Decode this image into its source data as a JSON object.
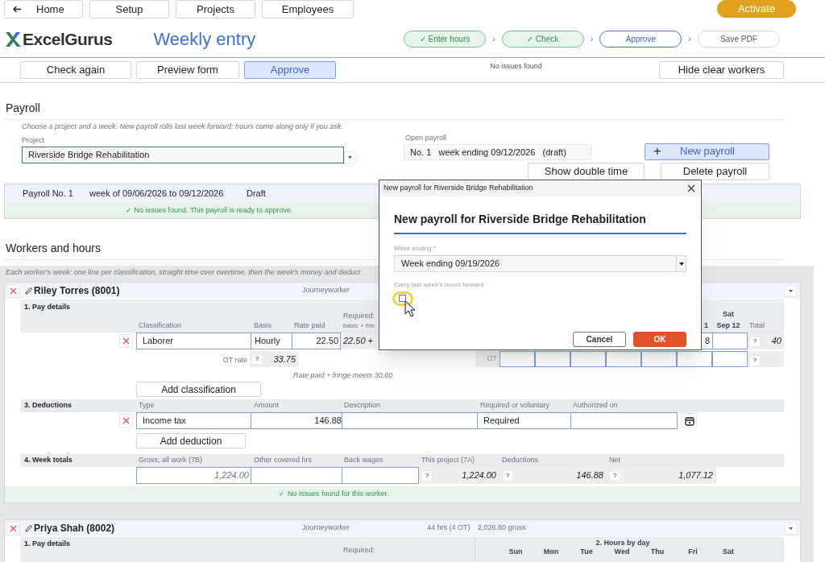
{
  "nav": {
    "back": "Home",
    "items": [
      "Setup",
      "Projects",
      "Employees"
    ],
    "activate": "Activate"
  },
  "header": {
    "logo": "ExcelGurus",
    "title": "Weekly entry",
    "steps": [
      {
        "label": "✓ Enter hours",
        "kind": "done"
      },
      {
        "separator": "›",
        "label": "✓ Check",
        "kind": "done"
      },
      {
        "separator": "›",
        "label": "Approve",
        "kind": "current"
      },
      {
        "separator": "›",
        "label": "Save PDF",
        "kind": "pending"
      }
    ]
  },
  "toolbar": {
    "buttons": [
      {
        "label": "Check again",
        "kind": "default"
      },
      {
        "label": "Preview form",
        "kind": "default"
      },
      {
        "label": "Approve",
        "kind": "primary"
      }
    ],
    "status": "No issues found",
    "right_button": "Hide clear workers"
  },
  "payroll": {
    "heading": "Payroll",
    "hint": "Choose a project and a week. New payroll rolls last week forward; hours come along only if you ask.",
    "project_label": "Project",
    "project": "Riverside Bridge Rehabilitation",
    "open_label": "Open payroll",
    "open_value": "No. 1   week ending 09/12/2026   (draft)",
    "new_button": {
      "icon": "+",
      "label": "New payroll"
    },
    "buttons": [
      "Show double time",
      "Delete payroll"
    ]
  },
  "summary": {
    "number": "Payroll No. 1",
    "week": "week of 09/06/2026 to 09/12/2026",
    "state": "Draft",
    "message": "✓ No issues found. This payroll is ready to approve."
  },
  "workers_section": {
    "heading": "Workers and hours",
    "hint": "Each worker's week: one line per classification, straight time over overtime, then the week's money and deduct"
  },
  "worker_1": {
    "name": "Riley Torres (8001)",
    "type": "Journeyworker",
    "pay": {
      "title": "1. Pay details",
      "columns": [
        "Classification",
        "Basis",
        "Rate paid"
      ],
      "required_label": [
        "Required:",
        "basic + frin"
      ],
      "row": {
        "classification": "Laborer",
        "basis": "Hourly",
        "rate_paid": "22.50",
        "required": "22.50 +"
      },
      "ot_label": "OT rate",
      "ot_help": "?",
      "ot_rate": "33.75",
      "note": "Rate paid + fringe meets 30.60"
    },
    "hours": {
      "fri_header": "1",
      "sat_header": [
        "Sat",
        "Sep 12"
      ],
      "total_label": "Total",
      "fri": "8",
      "st_help": "?",
      "st_total": "40",
      "ot_label": "OT",
      "ot_help": "?"
    },
    "add_classification": "Add classification",
    "deductions": {
      "title": "3. Deductions",
      "columns": [
        "Type",
        "Amount",
        "Description",
        "Required or voluntary",
        "Authorized on"
      ],
      "row": {
        "type": "Income tax",
        "amount": "146.88",
        "required": "Required"
      }
    },
    "add_deduction": "Add deduction",
    "totals": {
      "title": "4. Week totals",
      "columns": [
        "Gross, all work (7B)",
        "Other covered hrs",
        "Back wages",
        "This project (7A)",
        "Deductions",
        "Net"
      ],
      "gross": "1,224.00",
      "cells": [
        {
          "help": "?",
          "value": "1,224.00"
        },
        {
          "help": "?",
          "value": "146.88"
        },
        {
          "help": "?",
          "value": "1,077.12"
        }
      ]
    },
    "message": "✓ No issues found for this worker."
  },
  "worker_2": {
    "name": "Priya Shah (8002)",
    "type": "Journeyworker",
    "hours": "44 hrs (4 OT)",
    "gross": "2,026.80 gross",
    "pay_title": "1. Pay details",
    "required_label": "Required:",
    "hours_title": "2. Hours by day",
    "days": [
      "Sun",
      "Mon",
      "Tue",
      "Wed",
      "Thu",
      "Fri",
      "Sat"
    ]
  },
  "dialog": {
    "title": "New payroll for Riverside Bridge Rehabilitation",
    "heading": "New payroll for Riverside Bridge Rehabilitation",
    "week_label": "Week ending *",
    "week_value": "Week ending 09/19/2026",
    "carry_label": "Carry last week's hours forward",
    "carry_checked": false,
    "buttons": [
      {
        "label": "Cancel",
        "kind": "default"
      },
      {
        "label": "OK",
        "kind": "primary"
      }
    ]
  }
}
